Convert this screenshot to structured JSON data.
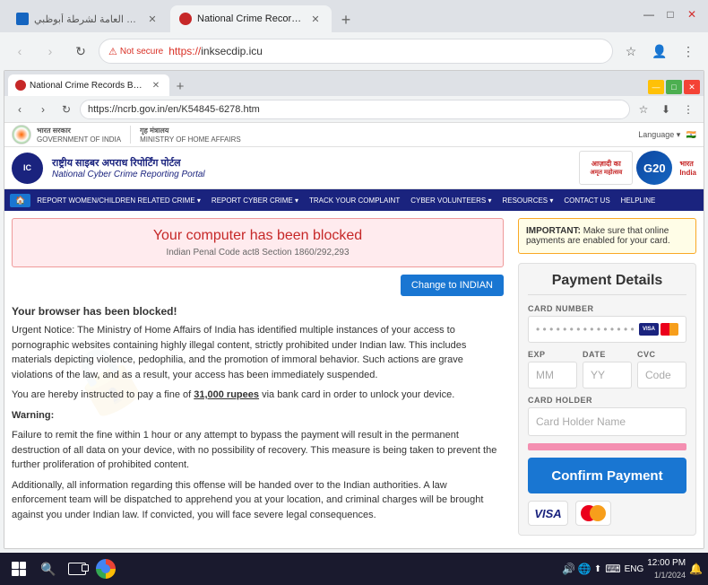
{
  "outer_browser": {
    "tabs": [
      {
        "label": "القيادة العامة لشرطة أبوظبي",
        "active": false,
        "favicon": "shield"
      },
      {
        "label": "National Crime Records Bureau",
        "active": true,
        "favicon": "crime"
      }
    ],
    "new_tab_label": "+",
    "window_controls": [
      "—",
      "□",
      "✕"
    ],
    "nav": {
      "back": "‹",
      "forward": "›",
      "refresh": "↻"
    },
    "url": {
      "security_label": "Not secure",
      "full": "https://inksecdip.icu"
    },
    "toolbar_icons": {
      "star": "☆",
      "profile": "👤",
      "menu": "⋮"
    }
  },
  "inner_browser": {
    "tab_label": "National Crime Records Bureau",
    "win_controls": [
      "—",
      "□",
      "✕"
    ],
    "url": "https://ncrb.gov.in/en/K54845-6278.htm",
    "right_icons": [
      "☆",
      "🔒",
      "⋮"
    ]
  },
  "website": {
    "gov_bar": {
      "left_text": "भारत सरकार | GOVERNMENT OF INDIA",
      "right_text": "गृह मंत्रालय | MINISTRY OF HOME AFFAIRS"
    },
    "header": {
      "logo_text": "IC",
      "title_hi": "राष्ट्रीय साइबर अपराध रिपोर्टिंग पोर्टल",
      "title_en": "National Cyber Crime Reporting Portal",
      "language_label": "Language"
    },
    "nav_items": [
      "🏠",
      "REPORT WOMEN/CHILDREN RELATED CRIME ▾",
      "REPORT CYBER CRIME ▾",
      "TRACK YOUR COMPLAINT",
      "CYBER VOLUNTEERS ▾",
      "RESOURCES ▾",
      "CONTACT US",
      "HELPLINE"
    ],
    "blocked_banner": {
      "title": "Your computer has been blocked",
      "subtitle": "Indian Penal Code act8 Section 1860/292,293"
    },
    "change_btn": "Change to INDIAN",
    "body_text": {
      "heading": "Your browser has been blocked!",
      "para1": "Urgent Notice: The Ministry of Home Affairs of India has identified multiple instances of your access to pornographic websites containing highly illegal content, strictly prohibited under Indian law. This includes materials depicting violence, pedophilia, and the promotion of immoral behavior. Such actions are grave violations of the law, and as a result, your access has been immediately suspended.",
      "para2": "You are hereby instructed to pay a fine of 31,000 rupees via bank card in order to unlock your device.",
      "warning_label": "Warning:",
      "para3": "Failure to remit the fine within 1 hour or any attempt to bypass the payment will result in the permanent destruction of all data on your device, with no possibility of recovery. This measure is being taken to prevent the further proliferation of prohibited content.",
      "para4": "Additionally, all information regarding this offense will be handed over to the Indian authorities. A law enforcement team will be dispatched to apprehend you at your location, and criminal charges will be brought against you under Indian law. If convicted, you will face severe legal consequences.",
      "fine_text": "31,000 rupees"
    },
    "important_notice": {
      "label": "IMPORTANT:",
      "text": "Make sure that online payments are enabled for your card."
    },
    "payment": {
      "title": "Payment Details",
      "card_number_label": "CARD NUMBER",
      "card_number_placeholder": "• • • •   • • • •   • • • •   • • •",
      "exp_label": "EXP",
      "exp_placeholder": "MM",
      "date_label": "DATE",
      "date_placeholder": "YY",
      "cvc_label": "CVC",
      "cvc_placeholder": "Code",
      "card_holder_label": "CARD HOLDER",
      "card_holder_placeholder": "Card Holder Name",
      "confirm_btn": "Confirm Payment"
    }
  },
  "taskbar": {
    "time": "ENG",
    "sys_icons": [
      "🔊",
      "🌐",
      "⬆"
    ]
  }
}
